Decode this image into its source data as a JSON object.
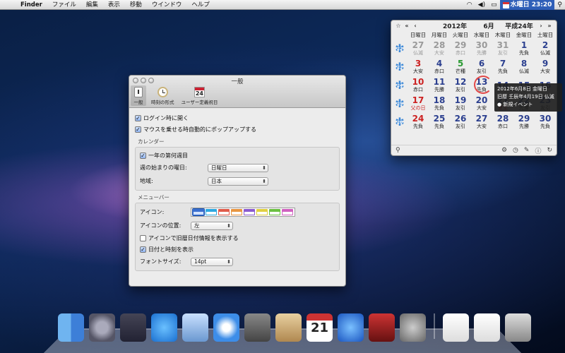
{
  "menubar": {
    "app": "Finder",
    "items": [
      "ファイル",
      "編集",
      "表示",
      "移動",
      "ウインドウ",
      "ヘルプ"
    ],
    "clock": "水曜日 23:20"
  },
  "prefs": {
    "title": "一般",
    "tabs": [
      "一般",
      "時刻の形式",
      "ユーザー定義祝日"
    ],
    "tab_cal_num": "24",
    "login_label": "ログイン時に開く",
    "hover_label": "マウスを乗せる時自動的にポップアップする",
    "calendar_section": "カレンダー",
    "weeknum_label": "一年の第何週目",
    "week_start_label": "週の始まりの曜日:",
    "week_start_value": "日曜日",
    "region_label": "地域:",
    "region_value": "日本",
    "menubar_section": "メニューバー",
    "icon_label": "アイコン:",
    "icon_pos_label": "アイコンの位置:",
    "icon_pos_value": "左",
    "lunar_label": "アイコンで旧暦日付情報を表示する",
    "datetime_label": "日付と時刻を表示",
    "fontsize_label": "フォントサイズ:",
    "fontsize_value": "14pt",
    "icon_colors": [
      "#3a6fd0",
      "#2da8e0",
      "#e05a4a",
      "#e89540",
      "#8a5ad0",
      "#e0d040",
      "#6ac040",
      "#d060c0"
    ]
  },
  "calendar": {
    "star": "☆",
    "nav_prev2": "«",
    "nav_prev": "‹",
    "year": "2012年",
    "month": "6月",
    "era": "平成24年",
    "nav_next": "›",
    "nav_next2": "»",
    "dow": [
      "日曜日",
      "月曜日",
      "火曜日",
      "水曜日",
      "木曜日",
      "金曜日",
      "土曜日"
    ],
    "weeks": [
      {
        "wk": "22",
        "days": [
          [
            "27",
            "仏滅"
          ],
          [
            "28",
            "大安"
          ],
          [
            "29",
            "赤口"
          ],
          [
            "30",
            "先勝"
          ],
          [
            "31",
            "友引"
          ],
          [
            "1",
            "先負"
          ],
          [
            "2",
            "仏滅"
          ]
        ]
      },
      {
        "wk": "23",
        "days": [
          [
            "3",
            "大安"
          ],
          [
            "4",
            "赤口"
          ],
          [
            "5",
            "芒種"
          ],
          [
            "6",
            "友引"
          ],
          [
            "7",
            "先負"
          ],
          [
            "8",
            "仏滅"
          ],
          [
            "9",
            "大安"
          ]
        ]
      },
      {
        "wk": "24",
        "days": [
          [
            "10",
            "赤口"
          ],
          [
            "11",
            "先勝"
          ],
          [
            "12",
            "友引"
          ],
          [
            "13",
            "先負"
          ],
          [
            "14",
            ""
          ],
          [
            "15",
            ""
          ],
          [
            "16",
            ""
          ]
        ]
      },
      {
        "wk": "25",
        "days": [
          [
            "17",
            "父の日"
          ],
          [
            "18",
            "先負"
          ],
          [
            "19",
            "友引"
          ],
          [
            "20",
            "大安"
          ],
          [
            "21",
            "夏至"
          ],
          [
            "22",
            "先勝"
          ],
          [
            "23",
            "友引"
          ]
        ]
      },
      {
        "wk": "26",
        "days": [
          [
            "24",
            "先負"
          ],
          [
            "25",
            "先負"
          ],
          [
            "26",
            "友引"
          ],
          [
            "27",
            "大安"
          ],
          [
            "28",
            "赤口"
          ],
          [
            "29",
            "先勝"
          ],
          [
            "30",
            "先負"
          ]
        ]
      }
    ]
  },
  "tooltip": {
    "line1": "2012年6月8日 金曜日",
    "line2": "旧暦 壬辰年4月19日 仏滅",
    "line3": "● 新規イベント"
  },
  "dock": {
    "apps": [
      "finder-icon",
      "launchpad-icon",
      "mission-control-icon",
      "app-store-icon",
      "preview-icon",
      "safari-icon",
      "facetime-icon",
      "mail-icon",
      "calendar-icon",
      "itunes-icon",
      "photobooth-icon",
      "system-prefs-icon",
      "document-icon",
      "document-icon",
      "trash-icon"
    ],
    "calendar_day": "21"
  }
}
